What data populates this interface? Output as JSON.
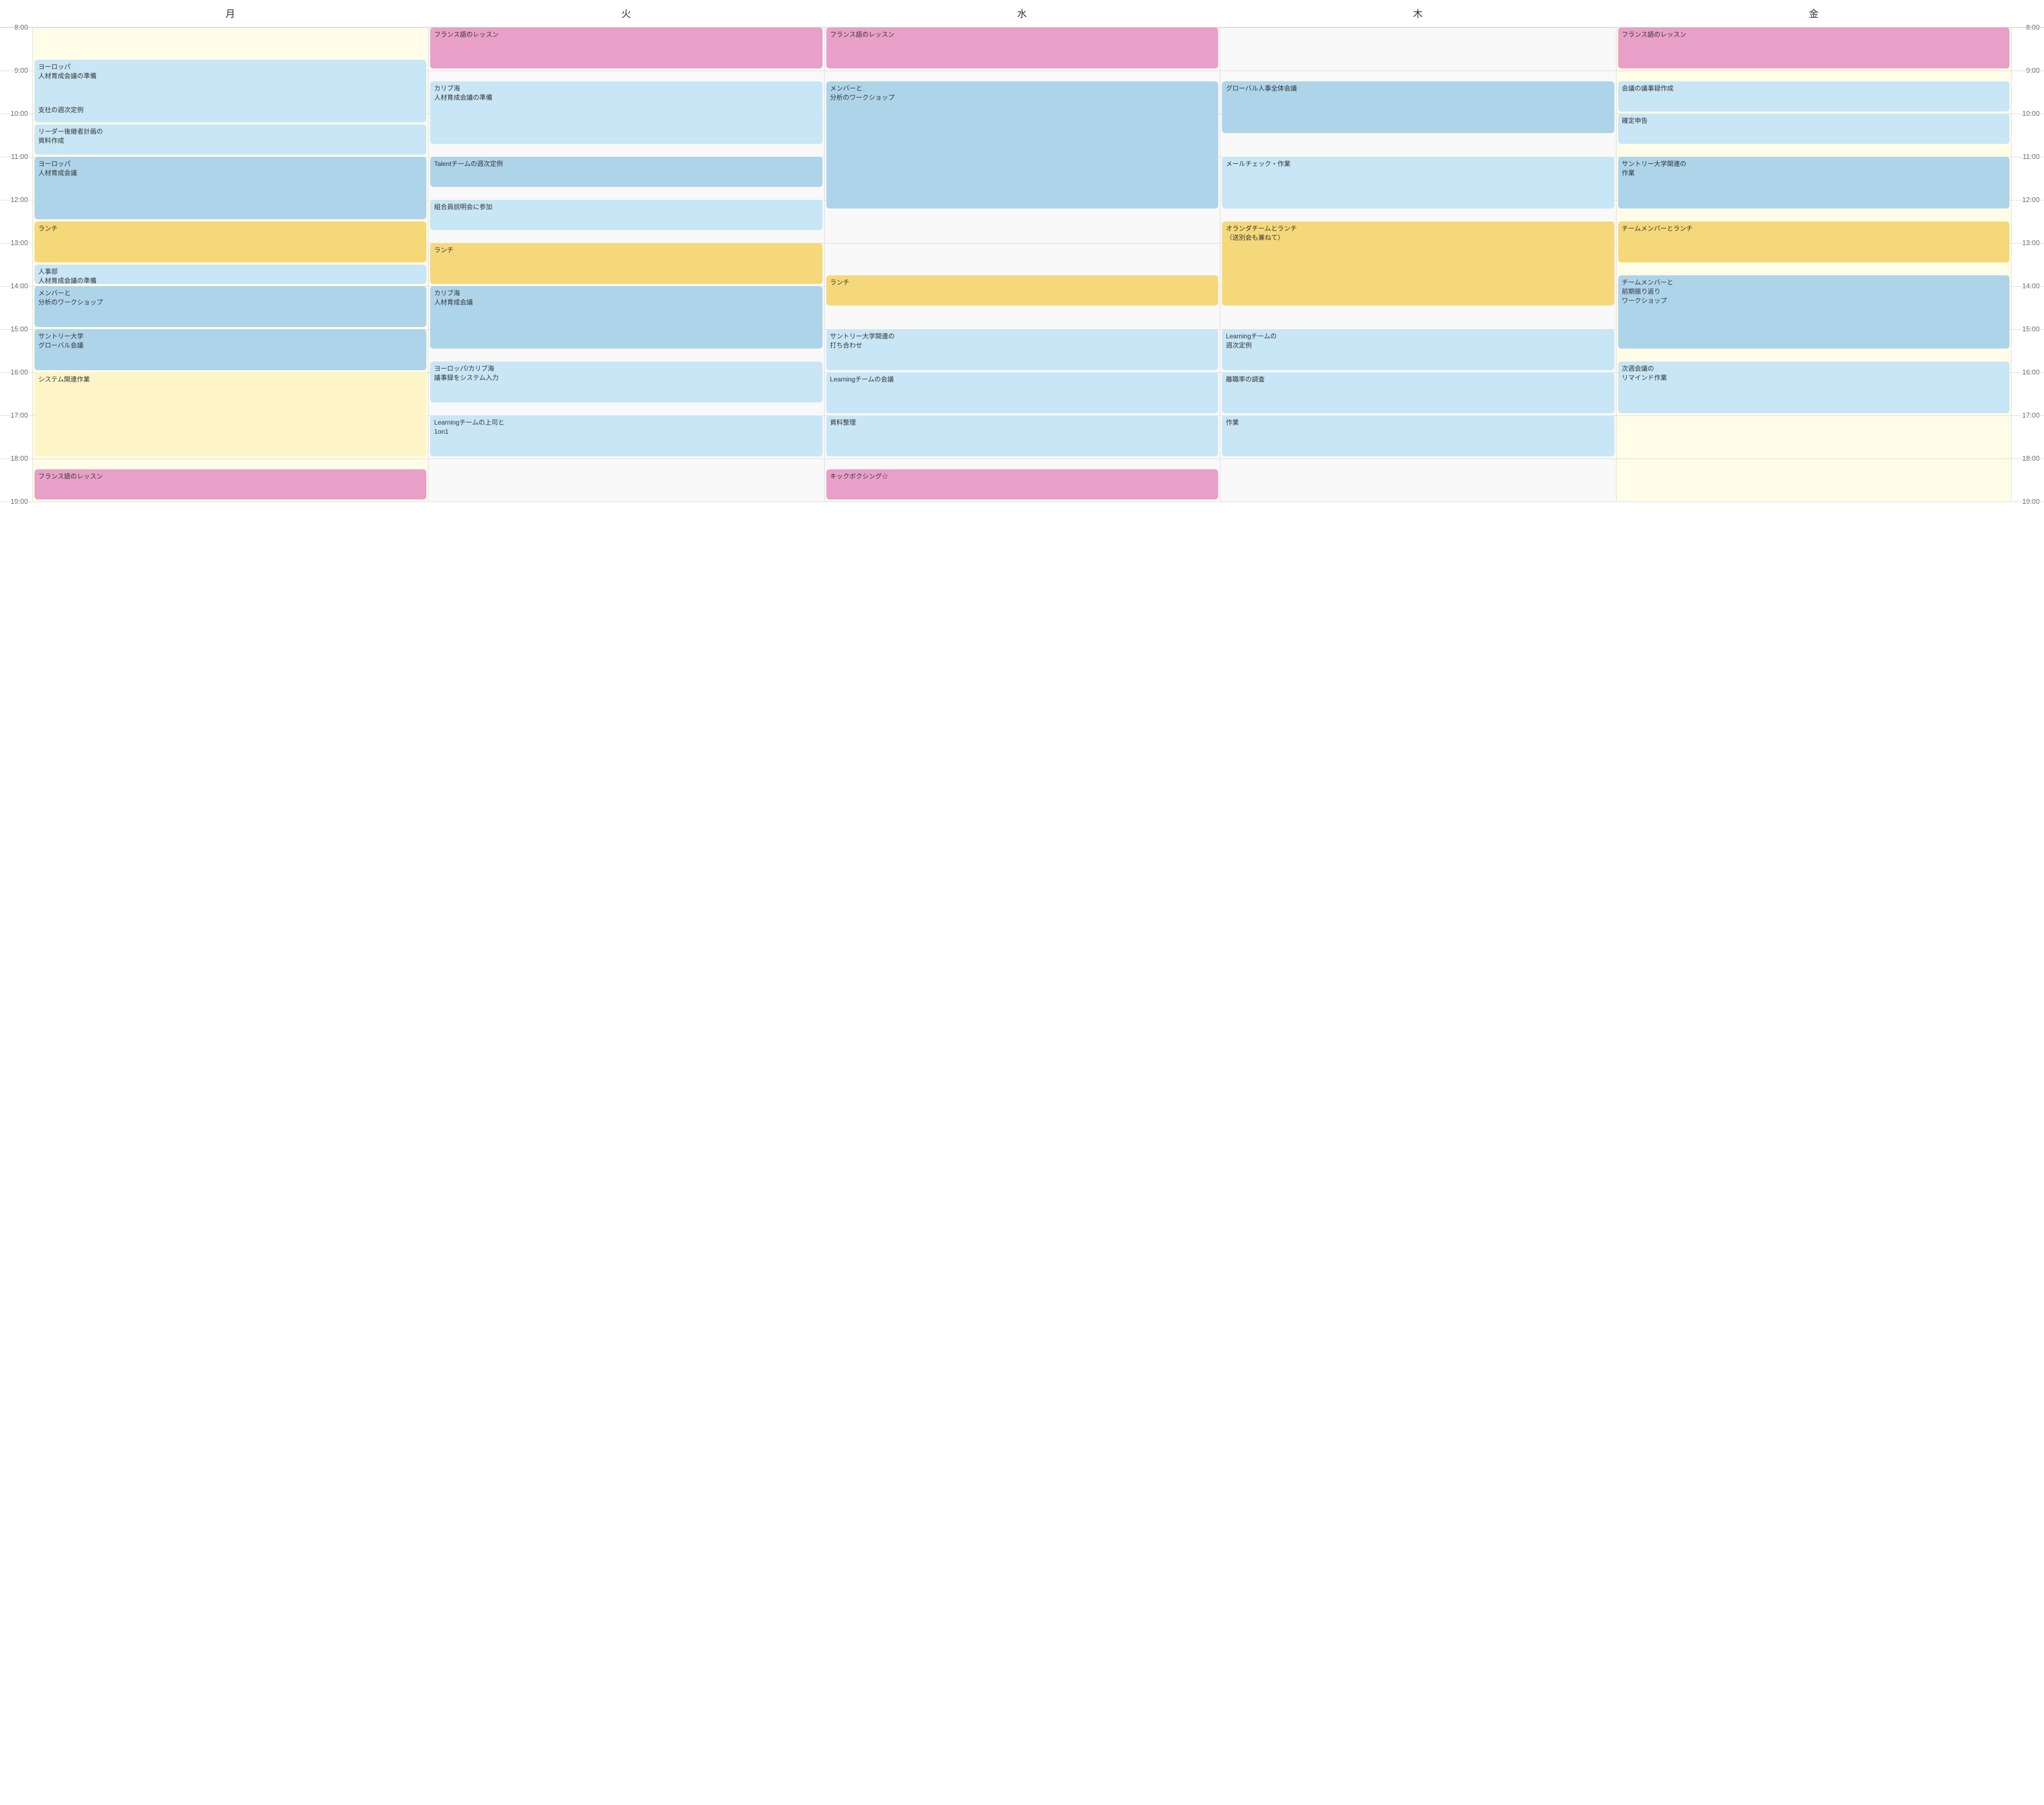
{
  "header": {
    "days": [
      "月",
      "火",
      "水",
      "木",
      "金"
    ],
    "times": [
      "8:00",
      "9:00",
      "10:00",
      "11:00",
      "12:00",
      "13:00",
      "14:00",
      "15:00",
      "16:00",
      "17:00",
      "18:00",
      "19:00"
    ]
  },
  "hourHeight": 80,
  "startHour": 8,
  "columns": [
    {
      "day": "月",
      "bg": "light-yellow-bg",
      "events": [
        {
          "id": "mon1",
          "label": "ヨーロッパ\n人材育成会議の準備",
          "start": 8.75,
          "end": 10.25,
          "color": "light-blue"
        },
        {
          "id": "mon2",
          "label": "支社の週次定例",
          "start": 9.75,
          "end": 10.25,
          "color": "light-blue"
        },
        {
          "id": "mon3",
          "label": "リーダー後継者計画の\n資料作成",
          "start": 10.25,
          "end": 11.0,
          "color": "light-blue"
        },
        {
          "id": "mon4",
          "label": "ヨーロッパ\n人材育成会議",
          "start": 11.0,
          "end": 12.5,
          "color": "blue"
        },
        {
          "id": "mon5",
          "label": "ランチ",
          "start": 12.5,
          "end": 13.5,
          "color": "yellow"
        },
        {
          "id": "mon6",
          "label": "人事部\n人材育成会議の準備",
          "start": 13.5,
          "end": 14.0,
          "color": "light-blue"
        },
        {
          "id": "mon7",
          "label": "メンバーと\n分析のワークショップ",
          "start": 14.0,
          "end": 15.0,
          "color": "blue"
        },
        {
          "id": "mon8",
          "label": "サントリー大学\nグローバル会議",
          "start": 15.0,
          "end": 16.0,
          "color": "blue"
        },
        {
          "id": "mon9",
          "label": "システム関連作業",
          "start": 16.0,
          "end": 18.0,
          "color": "light-yellow"
        },
        {
          "id": "mon10",
          "label": "フランス語のレッスン",
          "start": 18.25,
          "end": 19.0,
          "color": "pink"
        }
      ]
    },
    {
      "day": "火",
      "bg": "white-bg",
      "events": [
        {
          "id": "tue1",
          "label": "フランス語のレッスン",
          "start": 8.0,
          "end": 9.0,
          "color": "pink"
        },
        {
          "id": "tue2",
          "label": "カリブ海\n人材育成会議の準備",
          "start": 9.25,
          "end": 10.75,
          "color": "light-blue"
        },
        {
          "id": "tue3",
          "label": "Talentチームの週次定例",
          "start": 11.0,
          "end": 11.75,
          "color": "blue"
        },
        {
          "id": "tue4",
          "label": "組合員説明会に参加",
          "start": 12.0,
          "end": 12.75,
          "color": "light-blue"
        },
        {
          "id": "tue5",
          "label": "ランチ",
          "start": 13.0,
          "end": 14.0,
          "color": "yellow"
        },
        {
          "id": "tue6",
          "label": "カリブ海\n人材育成会議",
          "start": 14.0,
          "end": 15.5,
          "color": "blue"
        },
        {
          "id": "tue7",
          "label": "ヨーロッパ/カリブ海\n議事録をシステム入力",
          "start": 15.75,
          "end": 16.75,
          "color": "light-blue"
        },
        {
          "id": "tue8",
          "label": "Learningチームの上司と\n1on1",
          "start": 17.0,
          "end": 18.0,
          "color": "light-blue"
        }
      ]
    },
    {
      "day": "水",
      "bg": "white-bg",
      "events": [
        {
          "id": "wed1",
          "label": "フランス語のレッスン",
          "start": 8.0,
          "end": 9.0,
          "color": "pink"
        },
        {
          "id": "wed2",
          "label": "メンバーと\n分析のワークショップ",
          "start": 9.25,
          "end": 12.25,
          "color": "blue"
        },
        {
          "id": "wed3",
          "label": "ランチ",
          "start": 13.75,
          "end": 14.5,
          "color": "yellow"
        },
        {
          "id": "wed4",
          "label": "サントリー大学関連の\n打ち合わせ",
          "start": 15.0,
          "end": 16.0,
          "color": "light-blue"
        },
        {
          "id": "wed5",
          "label": "Learningチームの会議",
          "start": 16.0,
          "end": 17.0,
          "color": "light-blue"
        },
        {
          "id": "wed6",
          "label": "資料整理",
          "start": 17.0,
          "end": 18.0,
          "color": "light-blue"
        },
        {
          "id": "wed7",
          "label": "キックボクシング☆",
          "start": 18.25,
          "end": 19.0,
          "color": "pink"
        }
      ]
    },
    {
      "day": "木",
      "bg": "white-bg",
      "events": [
        {
          "id": "thu1",
          "label": "グローバル人事全体会議",
          "start": 9.25,
          "end": 10.5,
          "color": "blue"
        },
        {
          "id": "thu2",
          "label": "メールチェック・作業",
          "start": 11.0,
          "end": 12.25,
          "color": "light-blue"
        },
        {
          "id": "thu3",
          "label": "オランダチームとランチ\n（送別会も兼ねて）",
          "start": 12.5,
          "end": 14.5,
          "color": "yellow"
        },
        {
          "id": "thu4",
          "label": "Learningチームの\n週次定例",
          "start": 15.0,
          "end": 16.0,
          "color": "light-blue"
        },
        {
          "id": "thu5",
          "label": "離職率の調査",
          "start": 16.0,
          "end": 17.0,
          "color": "light-blue"
        },
        {
          "id": "thu6",
          "label": "作業",
          "start": 17.0,
          "end": 18.0,
          "color": "light-blue"
        }
      ]
    },
    {
      "day": "金",
      "bg": "light-yellow-bg",
      "events": [
        {
          "id": "fri1",
          "label": "フランス語のレッスン",
          "start": 8.0,
          "end": 9.0,
          "color": "pink"
        },
        {
          "id": "fri2",
          "label": "会議の議事録作成",
          "start": 9.25,
          "end": 10.0,
          "color": "light-blue"
        },
        {
          "id": "fri3",
          "label": "確定申告",
          "start": 10.0,
          "end": 10.75,
          "color": "light-blue"
        },
        {
          "id": "fri4",
          "label": "サントリー大学関連の\n作業",
          "start": 11.0,
          "end": 12.25,
          "color": "blue"
        },
        {
          "id": "fri5",
          "label": "チームメンバーとランチ",
          "start": 12.5,
          "end": 13.5,
          "color": "yellow"
        },
        {
          "id": "fri6",
          "label": "チームメンバーと\n前期振り返り\nワークショップ",
          "start": 13.75,
          "end": 15.5,
          "color": "blue"
        },
        {
          "id": "fri7",
          "label": "次週会議の\nリマインド作業",
          "start": 15.75,
          "end": 17.0,
          "color": "light-blue"
        }
      ]
    }
  ]
}
